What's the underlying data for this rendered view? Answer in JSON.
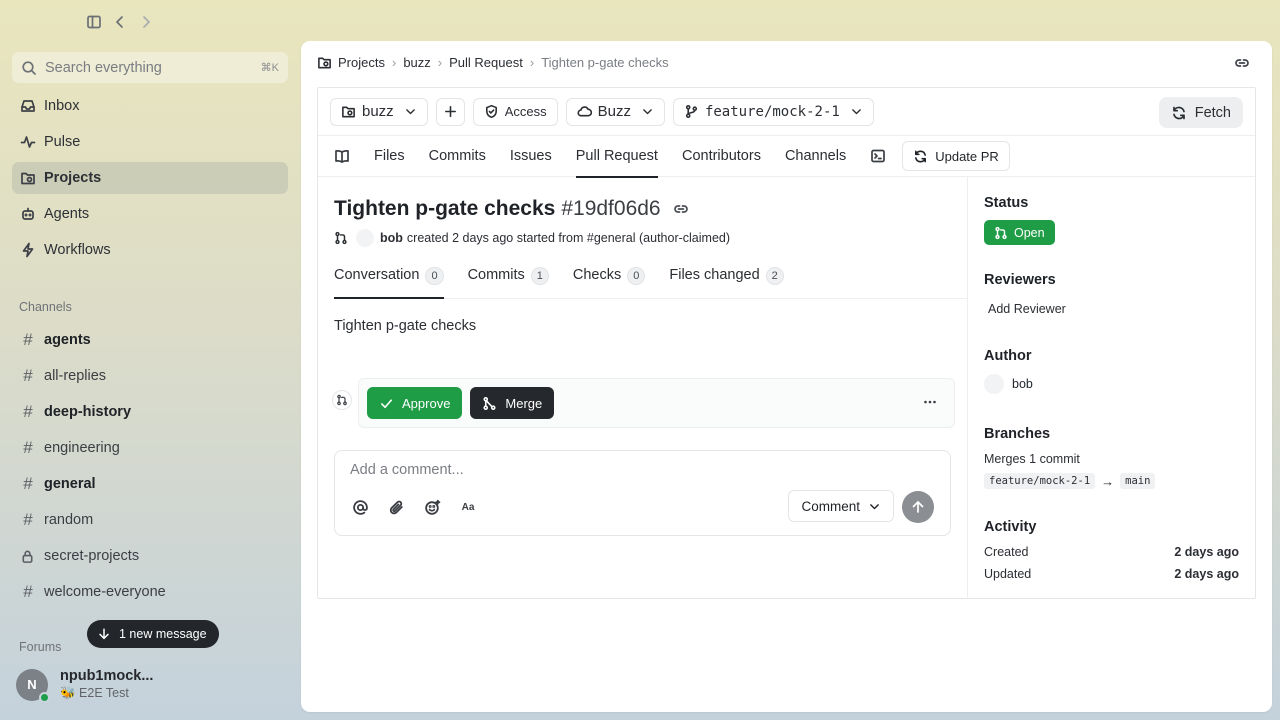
{
  "sidebar": {
    "search_placeholder": "Search everything",
    "search_shortcut": "⌘K",
    "nav": [
      {
        "label": "Inbox",
        "icon": "inbox-icon"
      },
      {
        "label": "Pulse",
        "icon": "pulse-icon"
      },
      {
        "label": "Projects",
        "icon": "projects-icon",
        "active": true
      },
      {
        "label": "Agents",
        "icon": "agents-icon"
      },
      {
        "label": "Workflows",
        "icon": "workflows-icon"
      }
    ],
    "channels_title": "Channels",
    "channels": [
      {
        "label": "agents",
        "bold": true
      },
      {
        "label": "all-replies",
        "bold": false
      },
      {
        "label": "deep-history",
        "bold": true
      },
      {
        "label": "engineering",
        "bold": false
      },
      {
        "label": "general",
        "bold": true
      },
      {
        "label": "random",
        "bold": false
      },
      {
        "label": "secret-projects",
        "bold": false,
        "locked": true
      },
      {
        "label": "welcome-everyone",
        "bold": false
      }
    ],
    "forums_title": "Forums",
    "new_message_toast": "1 new message",
    "user": {
      "initial": "N",
      "name": "npub1mock...",
      "status": "🐝 E2E Test"
    }
  },
  "breadcrumb": [
    "Projects",
    "buzz",
    "Pull Request",
    "Tighten p-gate checks"
  ],
  "toolbar": {
    "repo": "buzz",
    "access": "Access",
    "remote": "Buzz",
    "branch": "feature/mock-2-1",
    "fetch": "Fetch"
  },
  "tabs": [
    "Files",
    "Commits",
    "Issues",
    "Pull Request",
    "Contributors",
    "Channels"
  ],
  "active_tab": "Pull Request",
  "update_pr": "Update PR",
  "pr": {
    "title": "Tighten p-gate checks",
    "id": "#19df06d6",
    "author": "bob",
    "meta_text": "created 2 days ago started from #general (author-claimed)",
    "subtabs": [
      {
        "label": "Conversation",
        "count": "0",
        "active": true
      },
      {
        "label": "Commits",
        "count": "1"
      },
      {
        "label": "Checks",
        "count": "0"
      },
      {
        "label": "Files changed",
        "count": "2"
      }
    ],
    "description": "Tighten p-gate checks",
    "approve": "Approve",
    "merge": "Merge",
    "comment_placeholder": "Add a comment...",
    "comment_button": "Comment"
  },
  "side": {
    "status_title": "Status",
    "status": "Open",
    "reviewers_title": "Reviewers",
    "add_reviewer": "Add Reviewer",
    "author_title": "Author",
    "author": "bob",
    "branches_title": "Branches",
    "merges_text": "Merges 1 commit",
    "from_branch": "feature/mock-2-1",
    "arrow": "→",
    "to_branch": "main",
    "activity_title": "Activity",
    "created_label": "Created",
    "created_value": "2 days ago",
    "updated_label": "Updated",
    "updated_value": "2 days ago"
  },
  "colors": {
    "accent_green": "#1f9c46",
    "dark_button": "#25282c"
  }
}
